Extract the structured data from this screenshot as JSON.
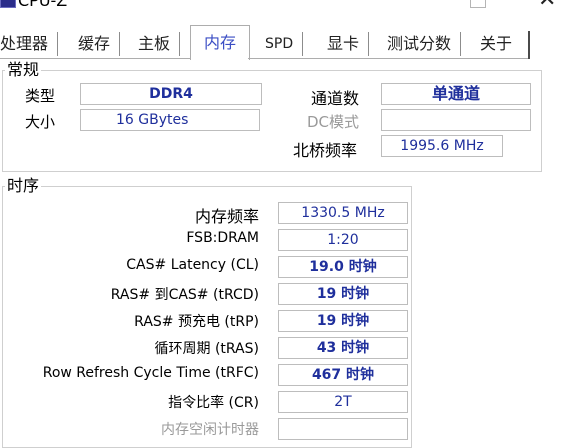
{
  "window": {
    "title": "CPU-Z",
    "maximize_glyph": "□",
    "close_glyph": "✕"
  },
  "tabs": {
    "items": [
      "处理器",
      "缓存",
      "主板",
      "内存",
      "SPD",
      "显卡",
      "测试分数",
      "关于"
    ],
    "active_label": "内存"
  },
  "general": {
    "legend": "常规",
    "type_label": "类型",
    "type_value": "DDR4",
    "size_label": "大小",
    "size_value": "16 GBytes",
    "channels_label": "通道数",
    "channels_value": "单通道",
    "dc_mode_label": "DC模式",
    "dc_mode_value": "",
    "nb_freq_label": "北桥频率",
    "nb_freq_value": "1995.6 MHz"
  },
  "timings": {
    "legend": "时序",
    "rows": [
      {
        "label": "内存频率",
        "value": "1330.5 MHz"
      },
      {
        "label": "FSB:DRAM",
        "value": "1:20"
      },
      {
        "label": "CAS# Latency (CL)",
        "value": "19.0 时钟"
      },
      {
        "label": "RAS# 到CAS# (tRCD)",
        "value": "19 时钟"
      },
      {
        "label": "RAS# 预充电 (tRP)",
        "value": "19 时钟"
      },
      {
        "label": "循环周期 (tRAS)",
        "value": "43 时钟"
      },
      {
        "label": "Row Refresh Cycle Time (tRFC)",
        "value": "467 时钟"
      },
      {
        "label": "指令比率 (CR)",
        "value": "2T"
      },
      {
        "label": "内存空闲计时器",
        "value": ""
      }
    ]
  },
  "colors": {
    "accent": "#3b4ec4",
    "value_text": "#1f2f9c",
    "border": "#bdbdbd"
  }
}
